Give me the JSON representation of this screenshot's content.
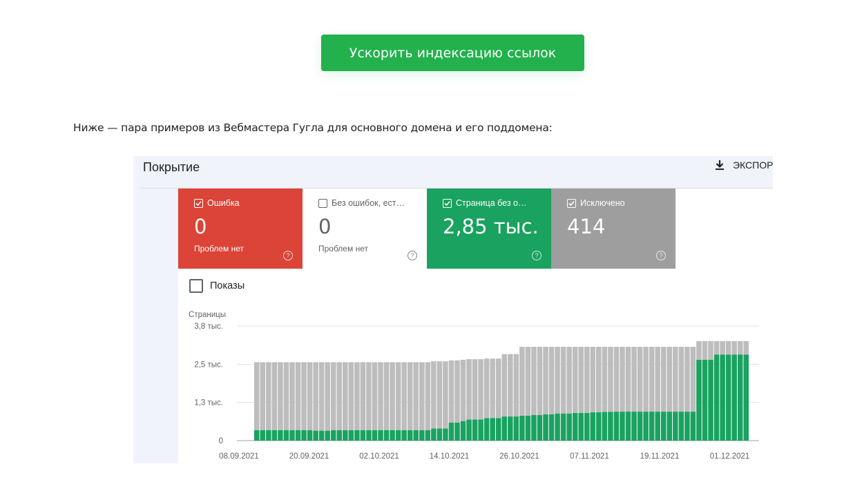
{
  "cta": {
    "label": "Ускорить индексацию ссылок"
  },
  "intro": {
    "text": "Ниже — пара примеров из Вебмастера Гугла для основного домена и его поддомена:"
  },
  "panel": {
    "title": "Покрытие",
    "export_label": "ЭКСПОР",
    "cards": [
      {
        "title": "Ошибка",
        "value": "0",
        "sub": "Проблем нет",
        "checked": true,
        "bg": "#db4437",
        "fg": "#ffffff"
      },
      {
        "title": "Без ошибок, ест…",
        "value": "0",
        "sub": "Проблем нет",
        "checked": false,
        "bg": "#ffffff",
        "fg": "#5f6368"
      },
      {
        "title": "Страница без о…",
        "value": "2,85 тыс.",
        "sub": "",
        "checked": true,
        "bg": "#1aa260",
        "fg": "#ffffff"
      },
      {
        "title": "Исключено",
        "value": "414",
        "sub": "",
        "checked": true,
        "bg": "#9e9e9e",
        "fg": "#ffffff"
      }
    ],
    "impressions_label": "Показы"
  },
  "chart_data": {
    "type": "bar",
    "stacked": true,
    "ylabel": "Страницы",
    "ylim": [
      0,
      3800
    ],
    "y_ticks": [
      {
        "value": 0,
        "label": "0"
      },
      {
        "value": 1266.7,
        "label": "1,3 тыс."
      },
      {
        "value": 2533.3,
        "label": "2,5 тыс."
      },
      {
        "value": 3800,
        "label": "3,8 тыс."
      }
    ],
    "x_tick_labels": [
      "08.09.2021",
      "20.09.2021",
      "02.10.2021",
      "14.10.2021",
      "26.10.2021",
      "07.11.2021",
      "19.11.2021",
      "01.12.2021"
    ],
    "colors": {
      "valid": "#1aa260",
      "excluded": "#bdbdbd"
    },
    "series": [
      {
        "name": "Страница без ошибок",
        "values": [
          350,
          350,
          350,
          350,
          350,
          350,
          350,
          350,
          350,
          350,
          330,
          330,
          330,
          350,
          350,
          350,
          350,
          350,
          350,
          350,
          350,
          350,
          350,
          350,
          350,
          350,
          350,
          350,
          350,
          350,
          400,
          400,
          400,
          600,
          600,
          650,
          700,
          700,
          700,
          750,
          750,
          750,
          800,
          800,
          800,
          830,
          830,
          850,
          850,
          870,
          870,
          900,
          900,
          900,
          920,
          920,
          920,
          940,
          940,
          950,
          950,
          960,
          960,
          960,
          960,
          960,
          960,
          960,
          960,
          960,
          960,
          960,
          960,
          960,
          960,
          2680,
          2680,
          2680,
          2850,
          2850,
          2850,
          2850,
          2850,
          2850
        ]
      },
      {
        "name": "Исключено",
        "values": [
          2250,
          2250,
          2250,
          2250,
          2250,
          2250,
          2250,
          2250,
          2250,
          2250,
          2270,
          2270,
          2270,
          2250,
          2250,
          2250,
          2250,
          2250,
          2250,
          2250,
          2250,
          2250,
          2250,
          2250,
          2250,
          2250,
          2250,
          2250,
          2250,
          2250,
          2230,
          2230,
          2230,
          2060,
          2060,
          2030,
          2000,
          2000,
          2000,
          1970,
          1970,
          1970,
          2070,
          2070,
          2070,
          2280,
          2280,
          2260,
          2260,
          2240,
          2240,
          2210,
          2210,
          2210,
          2190,
          2190,
          2190,
          2170,
          2170,
          2160,
          2160,
          2150,
          2150,
          2150,
          2150,
          2150,
          2150,
          2150,
          2150,
          2150,
          2150,
          2150,
          2150,
          2150,
          2150,
          620,
          620,
          620,
          450,
          450,
          450,
          450,
          450,
          450
        ]
      }
    ]
  }
}
